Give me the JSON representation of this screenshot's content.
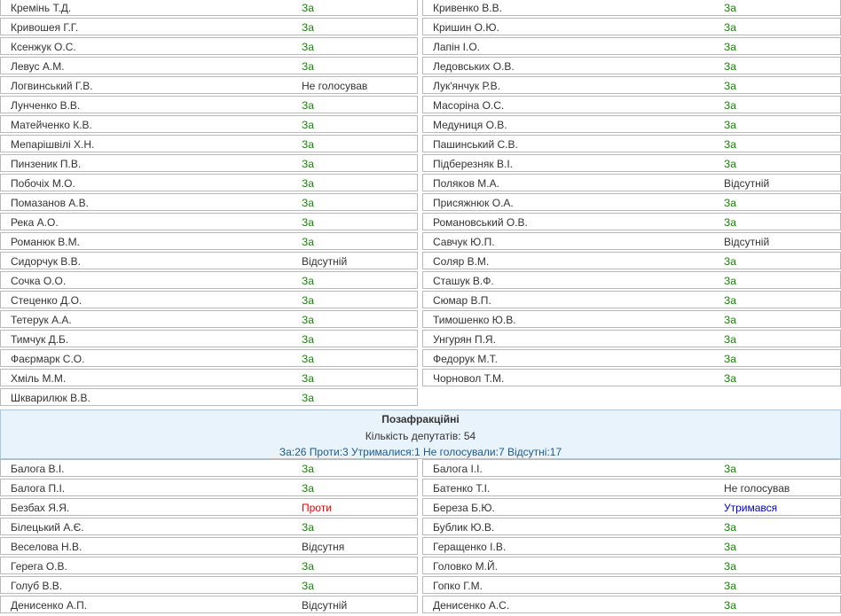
{
  "top_rows": [
    {
      "left": {
        "name": "Кремінь Т.Д.",
        "vote": "За",
        "kind": "za"
      },
      "right": {
        "name": "Кривенко В.В.",
        "vote": "За",
        "kind": "za"
      }
    },
    {
      "left": {
        "name": "Кривошея Г.Г.",
        "vote": "За",
        "kind": "za"
      },
      "right": {
        "name": "Кришин О.Ю.",
        "vote": "За",
        "kind": "za"
      }
    },
    {
      "left": {
        "name": "Ксенжук О.С.",
        "vote": "За",
        "kind": "za"
      },
      "right": {
        "name": "Лапін І.О.",
        "vote": "За",
        "kind": "za"
      }
    },
    {
      "left": {
        "name": "Левус А.М.",
        "vote": "За",
        "kind": "za"
      },
      "right": {
        "name": "Ледовських О.В.",
        "vote": "За",
        "kind": "za"
      }
    },
    {
      "left": {
        "name": "Логвинський Г.В.",
        "vote": "Не голосував",
        "kind": "neutral"
      },
      "right": {
        "name": "Лук'янчук Р.В.",
        "vote": "За",
        "kind": "za"
      }
    },
    {
      "left": {
        "name": "Лунченко В.В.",
        "vote": "За",
        "kind": "za"
      },
      "right": {
        "name": "Масоріна О.С.",
        "vote": "За",
        "kind": "za"
      }
    },
    {
      "left": {
        "name": "Матейченко К.В.",
        "vote": "За",
        "kind": "za"
      },
      "right": {
        "name": "Медуниця О.В.",
        "vote": "За",
        "kind": "za"
      }
    },
    {
      "left": {
        "name": "Мепарішвілі Х.Н.",
        "vote": "За",
        "kind": "za"
      },
      "right": {
        "name": "Пашинський С.В.",
        "vote": "За",
        "kind": "za"
      }
    },
    {
      "left": {
        "name": "Пинзеник П.В.",
        "vote": "За",
        "kind": "za"
      },
      "right": {
        "name": "Підберезняк В.І.",
        "vote": "За",
        "kind": "za"
      }
    },
    {
      "left": {
        "name": "Побочіх М.О.",
        "vote": "За",
        "kind": "za"
      },
      "right": {
        "name": "Поляков М.А.",
        "vote": "Відсутній",
        "kind": "neutral"
      }
    },
    {
      "left": {
        "name": "Помазанов А.В.",
        "vote": "За",
        "kind": "za"
      },
      "right": {
        "name": "Присяжнюк О.А.",
        "vote": "За",
        "kind": "za"
      }
    },
    {
      "left": {
        "name": "Река А.О.",
        "vote": "За",
        "kind": "za"
      },
      "right": {
        "name": "Романовський О.В.",
        "vote": "За",
        "kind": "za"
      }
    },
    {
      "left": {
        "name": "Романюк В.М.",
        "vote": "За",
        "kind": "za"
      },
      "right": {
        "name": "Савчук Ю.П.",
        "vote": "Відсутній",
        "kind": "neutral"
      }
    },
    {
      "left": {
        "name": "Сидорчук В.В.",
        "vote": "Відсутній",
        "kind": "neutral"
      },
      "right": {
        "name": "Соляр В.М.",
        "vote": "За",
        "kind": "za"
      }
    },
    {
      "left": {
        "name": "Сочка О.О.",
        "vote": "За",
        "kind": "za"
      },
      "right": {
        "name": "Сташук В.Ф.",
        "vote": "За",
        "kind": "za"
      }
    },
    {
      "left": {
        "name": "Стеценко Д.О.",
        "vote": "За",
        "kind": "za"
      },
      "right": {
        "name": "Сюмар В.П.",
        "vote": "За",
        "kind": "za"
      }
    },
    {
      "left": {
        "name": "Тетерук А.А.",
        "vote": "За",
        "kind": "za"
      },
      "right": {
        "name": "Тимошенко Ю.В.",
        "vote": "За",
        "kind": "za"
      }
    },
    {
      "left": {
        "name": "Тимчук Д.Б.",
        "vote": "За",
        "kind": "za"
      },
      "right": {
        "name": "Унгурян П.Я.",
        "vote": "За",
        "kind": "za"
      }
    },
    {
      "left": {
        "name": "Фаєрмарк С.О.",
        "vote": "За",
        "kind": "za"
      },
      "right": {
        "name": "Федорук М.Т.",
        "vote": "За",
        "kind": "za"
      }
    },
    {
      "left": {
        "name": "Хміль М.М.",
        "vote": "За",
        "kind": "za"
      },
      "right": {
        "name": "Чорновол Т.М.",
        "vote": "За",
        "kind": "za"
      }
    },
    {
      "left": {
        "name": "Шкварилюк В.В.",
        "vote": "За",
        "kind": "za"
      },
      "right": null
    }
  ],
  "section": {
    "title": "Позафракційні",
    "count": "Кількість депутатів: 54",
    "summary": "За:26 Проти:3 Утрималися:1 Не голосували:7 Відсутні:17"
  },
  "bottom_rows": [
    {
      "left": {
        "name": "Балога В.І.",
        "vote": "За",
        "kind": "za"
      },
      "right": {
        "name": "Балога І.І.",
        "vote": "За",
        "kind": "za"
      }
    },
    {
      "left": {
        "name": "Балога П.І.",
        "vote": "За",
        "kind": "za"
      },
      "right": {
        "name": "Батенко Т.І.",
        "vote": "Не голосував",
        "kind": "neutral"
      }
    },
    {
      "left": {
        "name": "Безбах Я.Я.",
        "vote": "Проти",
        "kind": "proty"
      },
      "right": {
        "name": "Береза Б.Ю.",
        "vote": "Утримався",
        "kind": "utr"
      }
    },
    {
      "left": {
        "name": "Білецький А.Є.",
        "vote": "За",
        "kind": "za"
      },
      "right": {
        "name": "Бублик Ю.В.",
        "vote": "За",
        "kind": "za"
      }
    },
    {
      "left": {
        "name": "Веселова Н.В.",
        "vote": "Відсутня",
        "kind": "neutral"
      },
      "right": {
        "name": "Геращенко І.В.",
        "vote": "За",
        "kind": "za"
      }
    },
    {
      "left": {
        "name": "Герега О.В.",
        "vote": "За",
        "kind": "za"
      },
      "right": {
        "name": "Головко М.Й.",
        "vote": "За",
        "kind": "za"
      }
    },
    {
      "left": {
        "name": "Голуб В.В.",
        "vote": "За",
        "kind": "za"
      },
      "right": {
        "name": "Гопко Г.М.",
        "vote": "За",
        "kind": "za"
      }
    },
    {
      "left": {
        "name": "Денисенко А.П.",
        "vote": "Відсутній",
        "kind": "neutral"
      },
      "right": {
        "name": "Денисенко А.С.",
        "vote": "За",
        "kind": "za"
      }
    }
  ],
  "colors": {
    "za": "#118800",
    "proty": "#ee0000",
    "utrymavsia": "#0000cc",
    "neutral": "#333333",
    "section_bg": "#e9f3fb",
    "section_summary": "#1c5a8f"
  }
}
